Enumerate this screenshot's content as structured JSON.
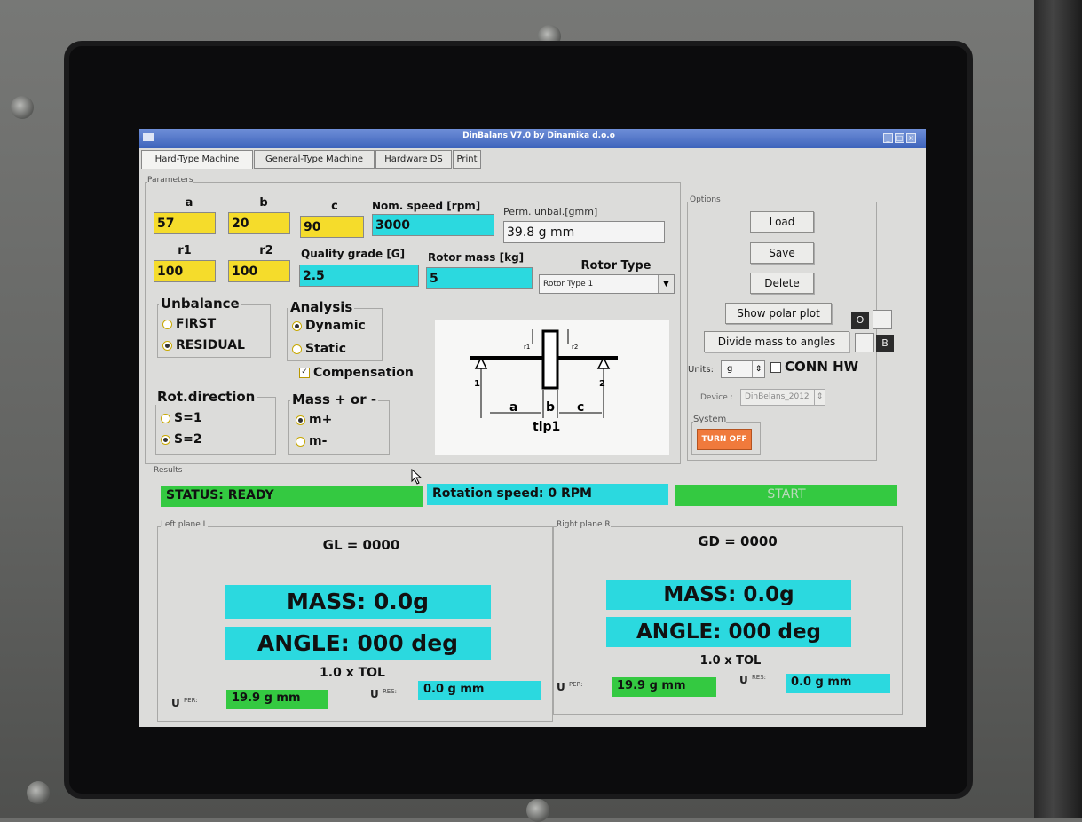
{
  "window": {
    "title": "DinBalans V7.0 by Dinamika d.o.o"
  },
  "tabs": [
    "Hard-Type Machine",
    "General-Type Machine",
    "Hardware DS",
    "Print"
  ],
  "parameters": {
    "group_label": "Parameters",
    "a_label": "a",
    "a_value": "57",
    "b_label": "b",
    "b_value": "20",
    "c_label": "c",
    "c_value": "90",
    "nom_speed_label": "Nom. speed [rpm]",
    "nom_speed_value": "3000",
    "perm_unbal_label": "Perm. unbal.[gmm]",
    "perm_unbal_value": "39.8 g mm",
    "r1_label": "r1",
    "r1_value": "100",
    "r2_label": "r2",
    "r2_value": "100",
    "quality_label": "Quality grade [G]",
    "quality_value": "2.5",
    "rotor_mass_label": "Rotor mass [kg]",
    "rotor_mass_value": "5",
    "rotor_type_label": "Rotor Type",
    "rotor_type_value": "Rotor Type 1"
  },
  "unbalance": {
    "label": "Unbalance",
    "options": [
      "FIRST",
      "RESIDUAL"
    ],
    "selected": "RESIDUAL"
  },
  "analysis": {
    "label": "Analysis",
    "options": [
      "Dynamic",
      "Static"
    ],
    "selected": "Dynamic",
    "compensation_label": "Compensation",
    "compensation_checked": true
  },
  "rot_direction": {
    "label": "Rot.direction",
    "options": [
      "S=1",
      "S=2"
    ],
    "selected": "S=2"
  },
  "mass_sign": {
    "label": "Mass + or -",
    "options": [
      "m+",
      "m-"
    ],
    "selected": "m+"
  },
  "diagram": {
    "a": "a",
    "b": "b",
    "c": "c",
    "caption": "tip1",
    "r1": "r1",
    "r2": "r2",
    "p1": "1",
    "p2": "2"
  },
  "options": {
    "group_label": "Options",
    "load": "Load",
    "save": "Save",
    "delete": "Delete",
    "show_polar": "Show polar plot",
    "divide_mass": "Divide mass to angles",
    "o_label": "O",
    "b_label": "B",
    "units_label": "Units:",
    "units_value": "g",
    "conn_hw": "CONN HW",
    "device_label": "Device :",
    "device_value": "DinBelans_2012",
    "system_label": "System",
    "turn_off": "TURN OFF"
  },
  "results": {
    "group_label": "Results",
    "status": "STATUS: READY",
    "rotation": "Rotation speed: 0 RPM",
    "start": "START",
    "left": {
      "label": "Left plane L",
      "g": "GL = 0000",
      "mass": "MASS: 0.0g",
      "angle": "ANGLE: 000 deg",
      "tol": "1.0 x TOL",
      "u_per": "19.9 g mm",
      "u_res": "0.0 g mm"
    },
    "right": {
      "label": "Right plane R",
      "g": "GD = 0000",
      "mass": "MASS: 0.0g",
      "angle": "ANGLE: 000 deg",
      "tol": "1.0 x TOL",
      "u_per": "19.9 g mm",
      "u_res": "0.0 g mm"
    },
    "u_label": "U",
    "per_label": "PER:",
    "res_label": "RES:"
  },
  "colors": {
    "yellow_field": "#f5dc2b",
    "cyan_field": "#2bd9df",
    "status_green": "#34c941",
    "turn_off": "#f07a3c"
  }
}
